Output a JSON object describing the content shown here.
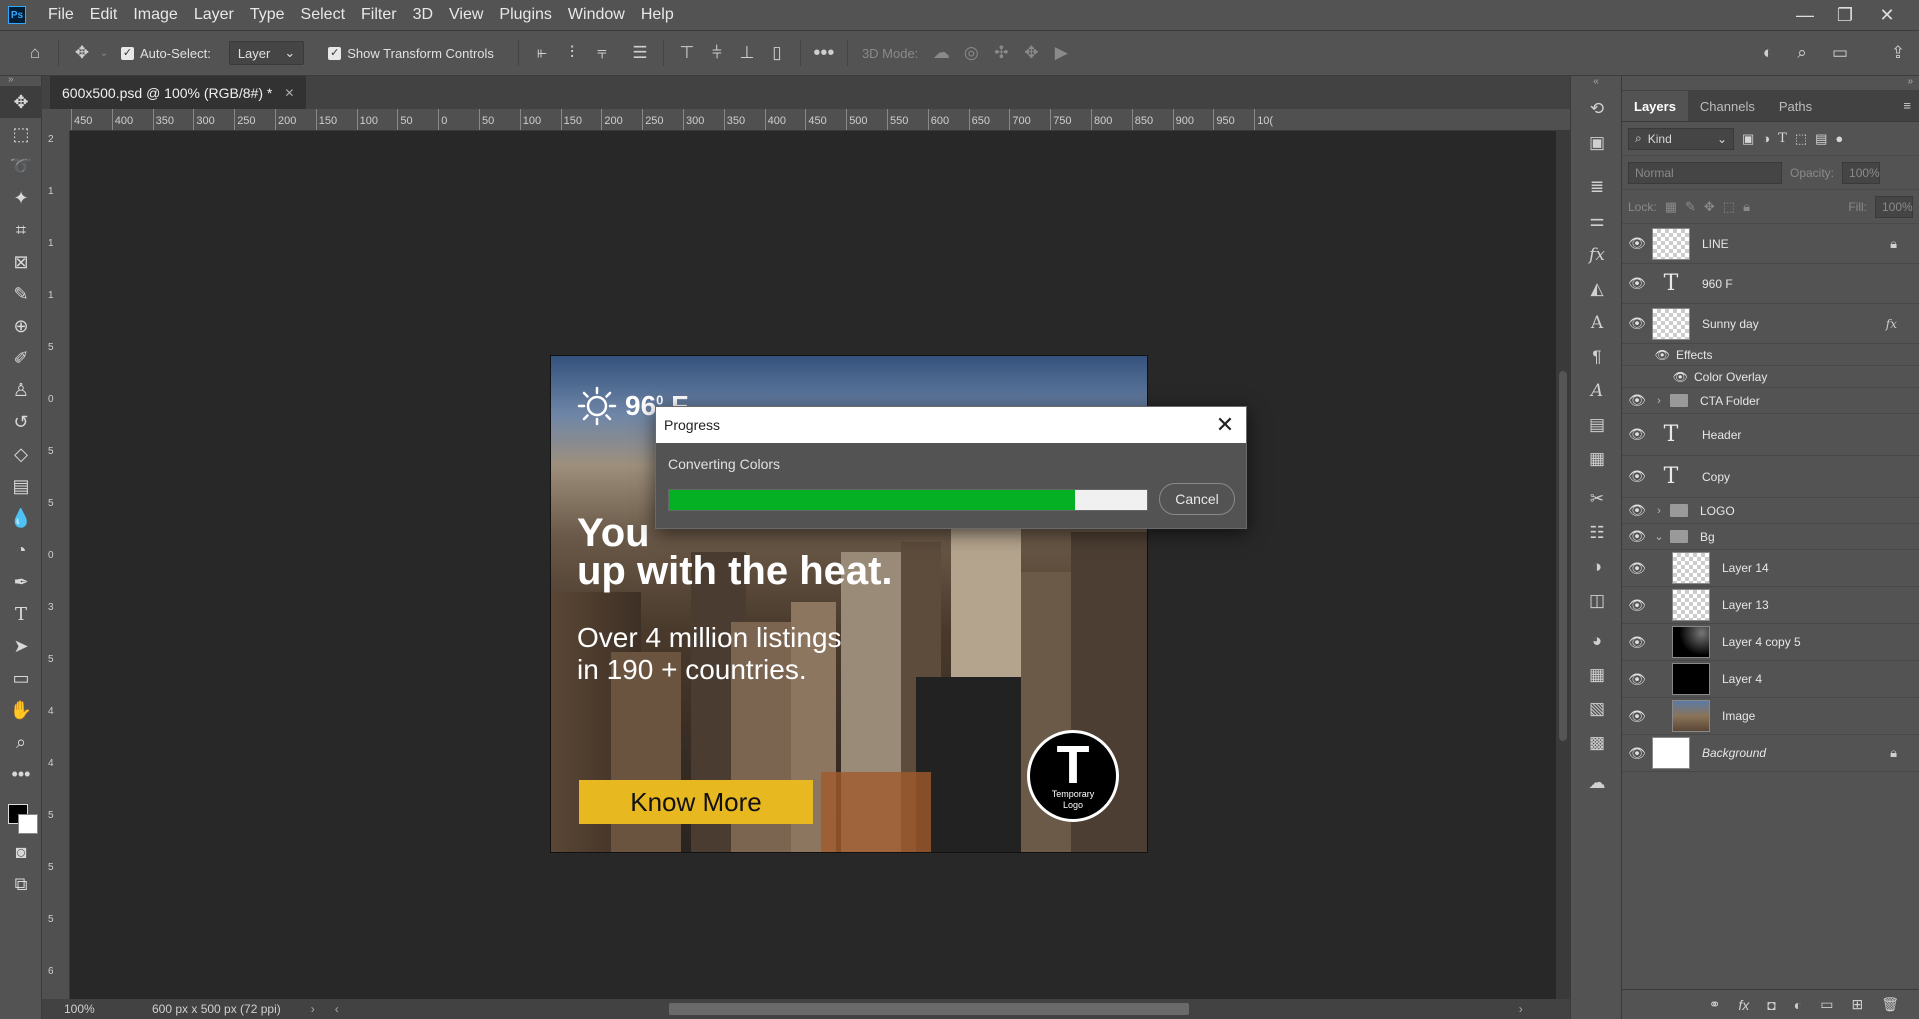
{
  "app": {
    "logo": "Ps"
  },
  "menu": [
    "File",
    "Edit",
    "Image",
    "Layer",
    "Type",
    "Select",
    "Filter",
    "3D",
    "View",
    "Plugins",
    "Window",
    "Help"
  ],
  "options": {
    "auto_select_label": "Auto-Select:",
    "auto_select_value": "Layer",
    "show_transform_label": "Show Transform Controls",
    "mode_3d_label": "3D Mode:"
  },
  "document": {
    "tab_title": "600x500.psd @ 100% (RGB/8#) *",
    "zoom": "100%",
    "doc_info": "600 px x 500 px (72 ppi)"
  },
  "ruler_h": [
    "450",
    "400",
    "350",
    "300",
    "250",
    "200",
    "150",
    "100",
    "50",
    "0",
    "50",
    "100",
    "150",
    "200",
    "250",
    "300",
    "350",
    "400",
    "450",
    "500",
    "550",
    "600",
    "650",
    "700",
    "750",
    "800",
    "850",
    "900",
    "950",
    "10("
  ],
  "ruler_v": [
    "2",
    "1",
    "1",
    "1",
    "5",
    "0",
    "5",
    "5",
    "0",
    "3",
    "5",
    "4",
    "4",
    "5",
    "5",
    "5",
    "6"
  ],
  "artwork": {
    "weather_temp": "96",
    "weather_deg": "0",
    "weather_unit": "F",
    "headline_line1": "You",
    "headline_line2": "up with the heat.",
    "subhead_line1": "Over 4 million listings",
    "subhead_line2": "in 190 + countries.",
    "cta_label": "Know More",
    "logo_letter": "T",
    "logo_line1": "Temporary",
    "logo_line2": "Logo"
  },
  "dialog": {
    "title": "Progress",
    "message": "Converting Colors",
    "progress": 0.85,
    "cancel_label": "Cancel"
  },
  "panel": {
    "tabs": [
      "Layers",
      "Channels",
      "Paths"
    ],
    "filter_kind": "Kind",
    "blend_mode": "Normal",
    "opacity_label": "Opacity:",
    "opacity_value": "100%",
    "lock_label": "Lock:",
    "fill_label": "Fill:",
    "fill_value": "100%"
  },
  "layers": [
    {
      "name": "LINE",
      "kind": "pixel",
      "locked": true
    },
    {
      "name": "960 F",
      "kind": "text"
    },
    {
      "name": "Sunny day",
      "kind": "pixel-fx"
    },
    {
      "name": "Effects",
      "kind": "effects"
    },
    {
      "name": "Color Overlay",
      "kind": "effect"
    },
    {
      "name": "CTA Folder",
      "kind": "folder"
    },
    {
      "name": "Header",
      "kind": "text"
    },
    {
      "name": "Copy",
      "kind": "text"
    },
    {
      "name": "LOGO",
      "kind": "folder"
    },
    {
      "name": "Bg",
      "kind": "folder-open"
    },
    {
      "name": "Layer 14",
      "kind": "pixel-child"
    },
    {
      "name": "Layer 13",
      "kind": "pixel-child"
    },
    {
      "name": "Layer 4 copy 5",
      "kind": "dark-child"
    },
    {
      "name": "Layer 4",
      "kind": "black-child"
    },
    {
      "name": "Image",
      "kind": "image-child"
    },
    {
      "name": "Background",
      "kind": "background",
      "locked": true
    }
  ]
}
